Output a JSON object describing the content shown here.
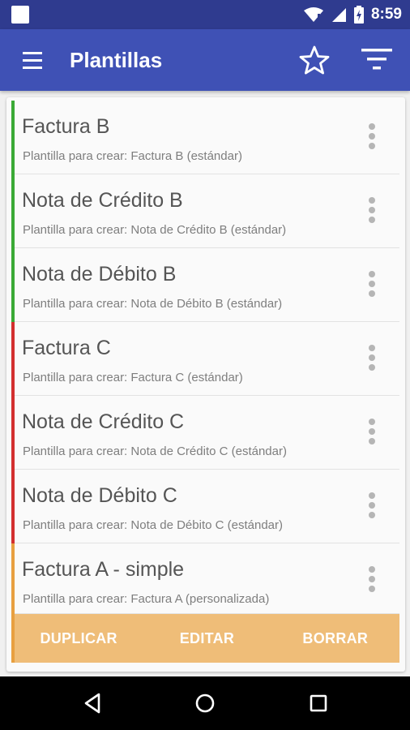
{
  "status_bar": {
    "time": "8:59"
  },
  "app_bar": {
    "title": "Plantillas"
  },
  "templates": [
    {
      "title": "Factura B",
      "subtitle": "Plantilla para crear: Factura B (estándar)",
      "color": "#3aaa35"
    },
    {
      "title": "Nota de Crédito B",
      "subtitle": "Plantilla para crear: Nota de Crédito B (estándar)",
      "color": "#3aaa35"
    },
    {
      "title": "Nota de Débito B",
      "subtitle": "Plantilla para crear: Nota de Débito B (estándar)",
      "color": "#3aaa35"
    },
    {
      "title": "Factura C",
      "subtitle": "Plantilla para crear: Factura C (estándar)",
      "color": "#d32f2f"
    },
    {
      "title": "Nota de Crédito C",
      "subtitle": "Plantilla para crear: Nota de Crédito C (estándar)",
      "color": "#d32f2f"
    },
    {
      "title": "Nota de Débito C",
      "subtitle": "Plantilla para crear: Nota de Débito C (estándar)",
      "color": "#d32f2f"
    },
    {
      "title": "Factura A - simple",
      "subtitle": "Plantilla para crear: Factura A (personalizada)",
      "color": "#e8a040"
    }
  ],
  "actions": {
    "duplicate": "DUPLICAR",
    "edit": "EDITAR",
    "delete": "BORRAR"
  },
  "colors": {
    "primary": "#3f51b5",
    "primary_dark": "#2f3b8f",
    "action_bar": "#efbd78"
  }
}
